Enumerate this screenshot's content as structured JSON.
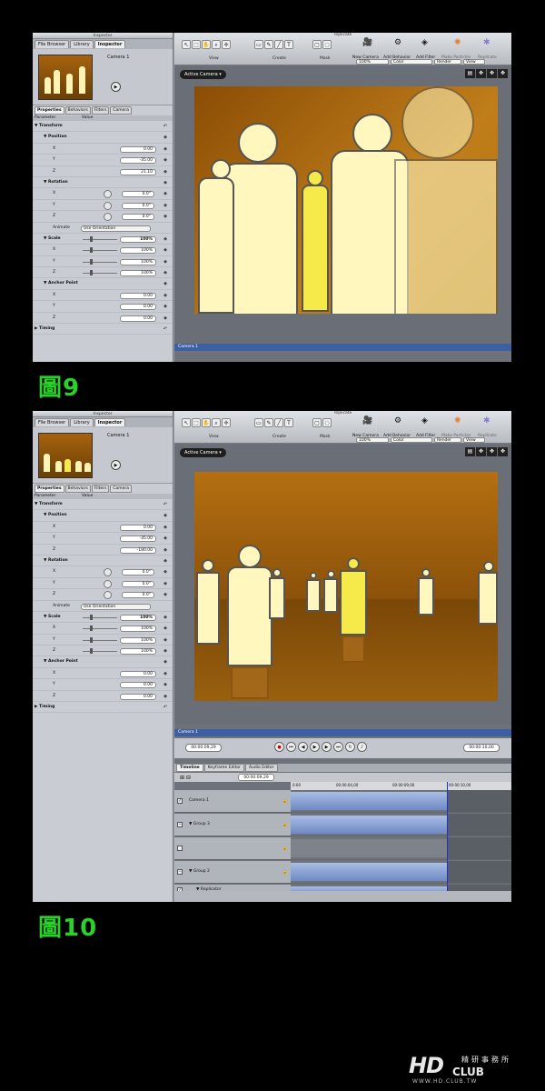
{
  "figure_labels": [
    "圖9",
    "圖10"
  ],
  "inspector": {
    "window_title": "Inspector",
    "tabs": [
      "File Browser",
      "Library",
      "Inspector"
    ],
    "camera_name": "Camera 1",
    "subtabs": [
      "Properties",
      "Behaviors",
      "Filters",
      "Camera"
    ],
    "columns": [
      "Parameter",
      "Value"
    ],
    "sections": {
      "transform": "Transform",
      "position": "Position",
      "rotation": "Rotation",
      "animate": "Animate",
      "animate_value": "Use Orientation",
      "scale": "Scale",
      "anchor_point": "Anchor Point",
      "timing": "Timing"
    },
    "axes": [
      "X",
      "Y",
      "Z"
    ]
  },
  "shot1": {
    "position": [
      "0.00",
      "-35.00",
      "21.10"
    ],
    "rotation": [
      "0.0°",
      "0.0°",
      "0.0°"
    ],
    "scale": [
      "100%",
      "100%",
      "100%"
    ],
    "anchor": [
      "0.00",
      "0.00",
      "0.00"
    ]
  },
  "shot2": {
    "position": [
      "0.00",
      "-35.00",
      "-180.00"
    ],
    "rotation": [
      "0.0°",
      "0.0°",
      "0.0°"
    ],
    "scale": [
      "100%",
      "100%",
      "100%"
    ],
    "anchor": [
      "0.00",
      "0.00",
      "0.00"
    ]
  },
  "main": {
    "window_title": "replicate",
    "groups": [
      "View",
      "Create",
      "Mask"
    ],
    "actions": [
      "New Camera",
      "Add Behavior",
      "Add Filter",
      "Make Particles",
      "Replicate"
    ],
    "zoom": "100%",
    "color": "Color",
    "render": "Render",
    "view": "View",
    "active_camera": "Active Camera",
    "camera_strip": "Camera 1"
  },
  "timeline": {
    "current_time": "00:00:09,29",
    "end_time": "00:00:10,00",
    "tabs": [
      "Timeline",
      "Keyframe Editor",
      "Audio Editor"
    ],
    "ruler": [
      "0:00",
      "00:00:04,00",
      "00:00:09,00",
      "00:00:10,00"
    ],
    "layers": [
      "Camera 1",
      "Group 3",
      "",
      "Group 2",
      "Replicator"
    ]
  },
  "watermark": {
    "brand": "HD",
    "club": "CLUB",
    "chinese": "精研事務所",
    "url": "WWW.HD.CLUB.TW"
  }
}
